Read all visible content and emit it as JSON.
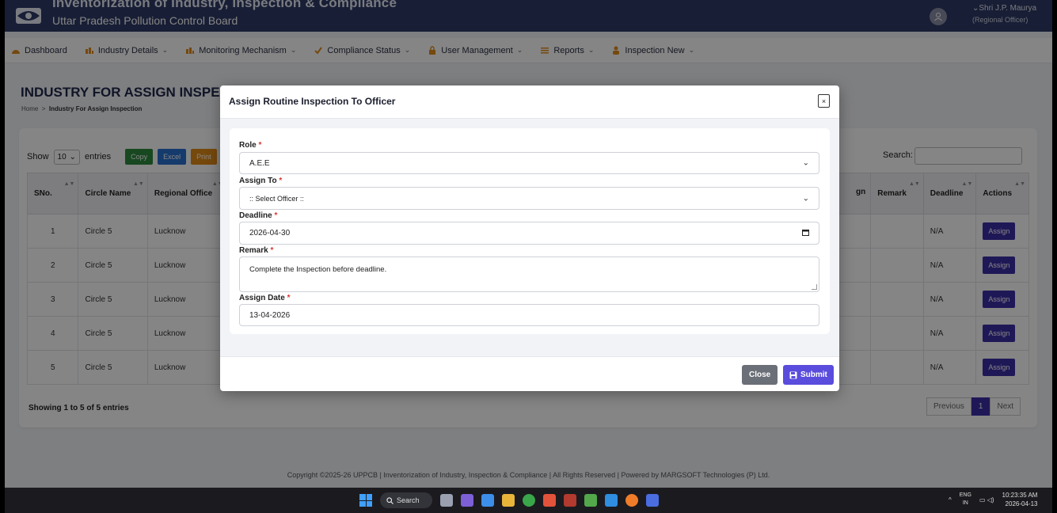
{
  "header": {
    "app_title": "Inventorization of Industry, Inspection & Compliance",
    "board_name": "Uttar Pradesh Pollution Control Board",
    "user_name": "Shri J.P. Maurya",
    "user_role": "(Regional Officer)"
  },
  "nav": [
    {
      "label": "Dashboard",
      "icon": "dashboard-icon",
      "chevron": ""
    },
    {
      "label": "Industry Details",
      "icon": "industry-icon",
      "chevron": "⌄"
    },
    {
      "label": "Monitoring Mechanism",
      "icon": "industry-icon",
      "chevron": "⌄"
    },
    {
      "label": "Compliance Status",
      "icon": "compliance-icon",
      "chevron": "⌄"
    },
    {
      "label": "User Management",
      "icon": "lock-icon",
      "chevron": "⌄"
    },
    {
      "label": "Reports",
      "icon": "list-icon",
      "chevron": "⌄"
    },
    {
      "label": "Inspection New",
      "icon": "user-icon",
      "chevron": "⌄"
    }
  ],
  "page": {
    "title": "INDUSTRY FOR ASSIGN INSPECTION",
    "breadcrumb_home": "Home",
    "breadcrumb_sep": ">",
    "breadcrumb_current": "Industry For Assign Inspection"
  },
  "table_controls": {
    "show": "Show",
    "length": "10",
    "entries": "entries",
    "copy": "Copy",
    "excel": "Excel",
    "print": "Print",
    "search_label": "Search:"
  },
  "table": {
    "headers_left": [
      "SNo.",
      "Circle Name",
      "Regional Office"
    ],
    "header_partial": "gn",
    "headers_right": [
      "Remark",
      "Deadline",
      "Actions"
    ],
    "rows": [
      {
        "sno": "1",
        "circle": "Circle 5",
        "office": "Lucknow",
        "deadline": "N/A",
        "action": "Assign"
      },
      {
        "sno": "2",
        "circle": "Circle 5",
        "office": "Lucknow",
        "deadline": "N/A",
        "action": "Assign"
      },
      {
        "sno": "3",
        "circle": "Circle 5",
        "office": "Lucknow",
        "deadline": "N/A",
        "action": "Assign"
      },
      {
        "sno": "4",
        "circle": "Circle 5",
        "office": "Lucknow",
        "deadline": "N/A",
        "action": "Assign"
      },
      {
        "sno": "5",
        "circle": "Circle 5",
        "office": "Lucknow",
        "deadline": "N/A",
        "action": "Assign"
      }
    ],
    "showing": "Showing 1 to 5 of 5 entries",
    "pager": {
      "previous": "Previous",
      "page": "1",
      "next": "Next"
    }
  },
  "modal": {
    "title": "Assign Routine Inspection To Officer",
    "close_x": "×",
    "required_mark": "*",
    "role_label": "Role",
    "role_value": "A.E.E",
    "assign_to_label": "Assign To",
    "assign_to_value": ":: Select Officer ::",
    "deadline_label": "Deadline",
    "deadline_value": "2026-04-30",
    "remark_label": "Remark",
    "remark_value": "Complete the Inspection before deadline.",
    "assign_date_label": "Assign Date",
    "assign_date_value": "13-04-2026",
    "close_button": "Close",
    "submit_button": "Submit"
  },
  "footer": {
    "text": "Copyright ©2025-26 UPPCB | Inventorization of Industry, Inspection & Compliance | All Rights Reserved | Powered by MARGSOFT Technologies (P) Ltd."
  },
  "taskbar": {
    "search": "Search",
    "lang_top": "ENG",
    "lang_bottom": "IN",
    "time": "10:23:35 AM",
    "date": "2026-04-13"
  },
  "colors": {
    "header_bg": "#2e3a66",
    "primary": "#3d2fa8",
    "submit": "#5a4cdc"
  }
}
